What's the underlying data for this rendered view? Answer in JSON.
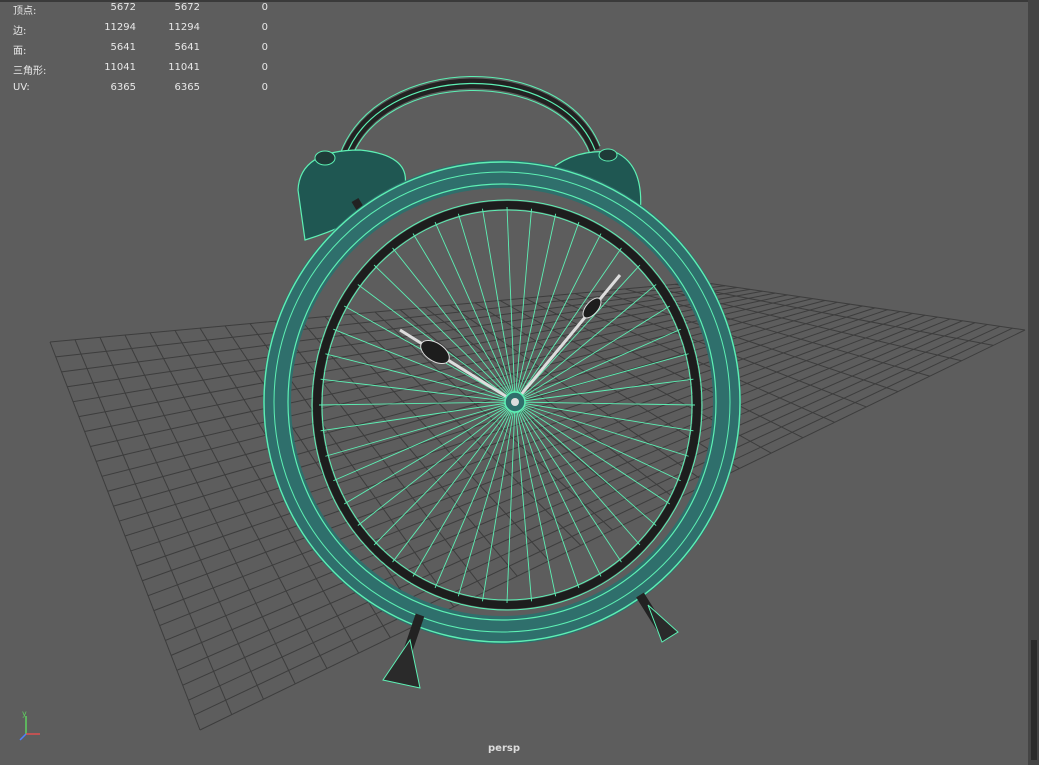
{
  "viewport": {
    "camera_label": "persp"
  },
  "heads_up_display": {
    "rows": [
      {
        "label": "顶点:",
        "values": [
          "5672",
          "5672",
          "0"
        ]
      },
      {
        "label": "边:",
        "values": [
          "11294",
          "11294",
          "0"
        ]
      },
      {
        "label": "面:",
        "values": [
          "5641",
          "5641",
          "0"
        ]
      },
      {
        "label": "三角形:",
        "values": [
          "11041",
          "11041",
          "0"
        ]
      },
      {
        "label": "UV:",
        "values": [
          "6365",
          "6365",
          "0"
        ]
      }
    ]
  },
  "axis_gizmo": {
    "y_label": "y",
    "x_label": "x",
    "z_label": "z"
  },
  "colors": {
    "viewport_bg": "#5d5d5d",
    "grid": "#3f3f3f",
    "wireframe": "#5df0b4",
    "mesh_dark": "#1f5752",
    "mesh_shade": "#2f6f6c"
  }
}
